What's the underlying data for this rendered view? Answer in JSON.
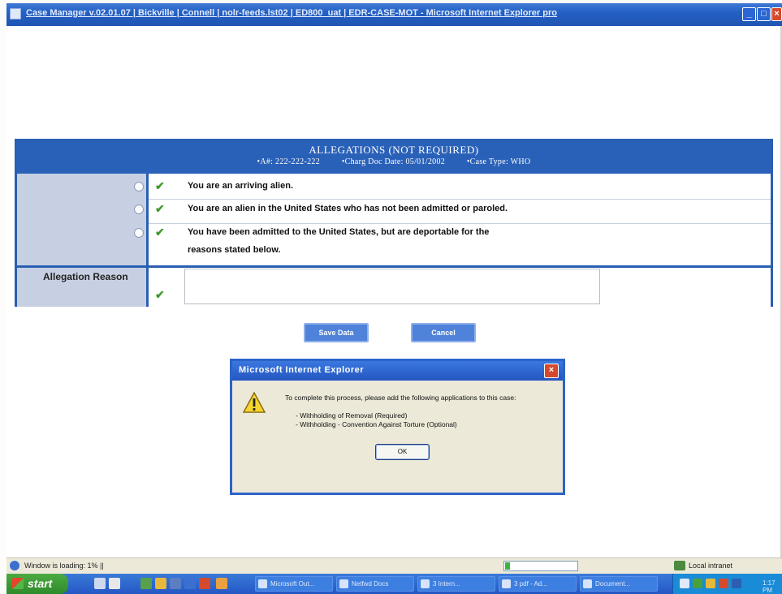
{
  "window": {
    "title": "Case Manager v.02.01.07 | Bickville | Connell | nolr-feeds.lst02 | ED800_uat | EDR-CASE-MOT - Microsoft Internet Explorer pro",
    "minimize_label": "_",
    "maximize_label": "□",
    "close_label": "×"
  },
  "panel": {
    "title": "ALLEGATIONS (NOT REQUIRED)",
    "a_number": "•A#: 222-222-222",
    "charg_doc_date": "•Charg Doc Date: 05/01/2002",
    "case_type": "•Case Type: WHO",
    "options": [
      {
        "label": "You are an arriving alien.",
        "selected": false
      },
      {
        "label": "You are an alien in the United States who has not been admitted or paroled.",
        "selected": false
      },
      {
        "label_line1": "You have been admitted to the United States, but are deportable for the",
        "label_line2": "reasons stated below.",
        "selected": false
      }
    ],
    "reason_label": "Allegation Reason",
    "reason_value": ""
  },
  "buttons": {
    "save_label": "Save Data",
    "cancel_label": "Cancel"
  },
  "dialog": {
    "title": "Microsoft Internet Explorer",
    "message": "To complete this process, please add the following applications to this case:",
    "items": [
      "- Withholding of Removal (Required)",
      "- Withholding - Convention Against Torture (Optional)"
    ],
    "ok_label": "OK",
    "close_label": "×"
  },
  "statusbar": {
    "text": "Window is loading: 1% ||",
    "progress_fraction": 0.01,
    "zone": "Local intranet"
  },
  "taskbar": {
    "start_label": "start",
    "tasks": [
      "Microsoft Out...",
      "Netfwd Docs",
      "3 Intern...",
      "3 pdf - Ad...",
      "Document..."
    ],
    "clock": "1:17 PM"
  },
  "colors": {
    "panel_blue": "#2a5fb2",
    "check_green": "#3f9a2c",
    "titlebar_blue": "#2460c4"
  }
}
